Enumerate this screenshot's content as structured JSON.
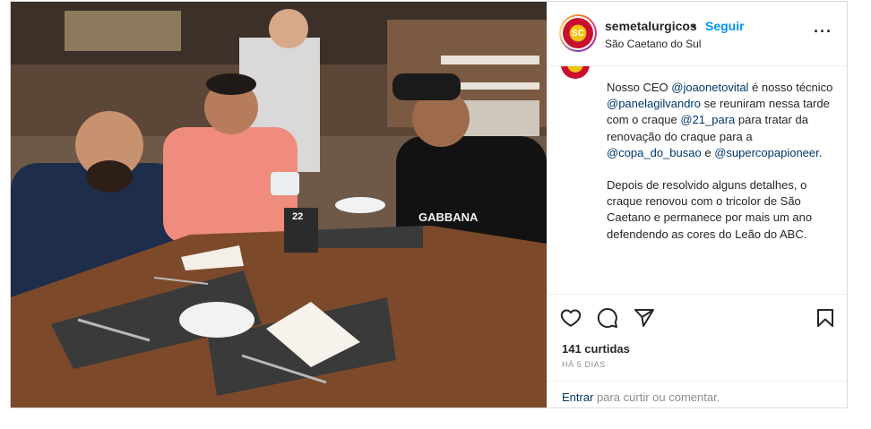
{
  "header": {
    "username": "semetalurgicos",
    "separator": "•",
    "follow_label": "Seguir",
    "location": "São Caetano do Sul",
    "more_icon": "more-horizontal-icon"
  },
  "photo": {
    "cap_text": "",
    "shirt_text": "GABBANA",
    "table_number": "22"
  },
  "caption": {
    "p1": [
      {
        "t": "Nosso CEO ",
        "m": false
      },
      {
        "t": "@joaonetovital",
        "m": true
      },
      {
        "t": " é nosso técnico ",
        "m": false
      },
      {
        "t": "@panelagilvandro",
        "m": true
      },
      {
        "t": " se reuniram nessa tarde com o craque ",
        "m": false
      },
      {
        "t": "@21_para",
        "m": true
      },
      {
        "t": " para tratar da renovação do craque para a ",
        "m": false
      },
      {
        "t": "@copa_do_busao",
        "m": true
      },
      {
        "t": " e ",
        "m": false
      },
      {
        "t": "@supercopapioneer",
        "m": true
      },
      {
        "t": ".",
        "m": false
      }
    ],
    "p2": "Depois de resolvido alguns detalhes, o craque renovou com o tricolor de São Caetano e permanece por mais um ano defendendo as cores do Leão do ABC."
  },
  "actions": {
    "like_icon": "heart-icon",
    "comment_icon": "comment-icon",
    "share_icon": "send-icon",
    "save_icon": "bookmark-icon"
  },
  "likes": "141 curtidas",
  "time": "HÁ 5 DIAS",
  "comment": {
    "enter_label": "Entrar",
    "rest": " para curtir ou comentar."
  }
}
